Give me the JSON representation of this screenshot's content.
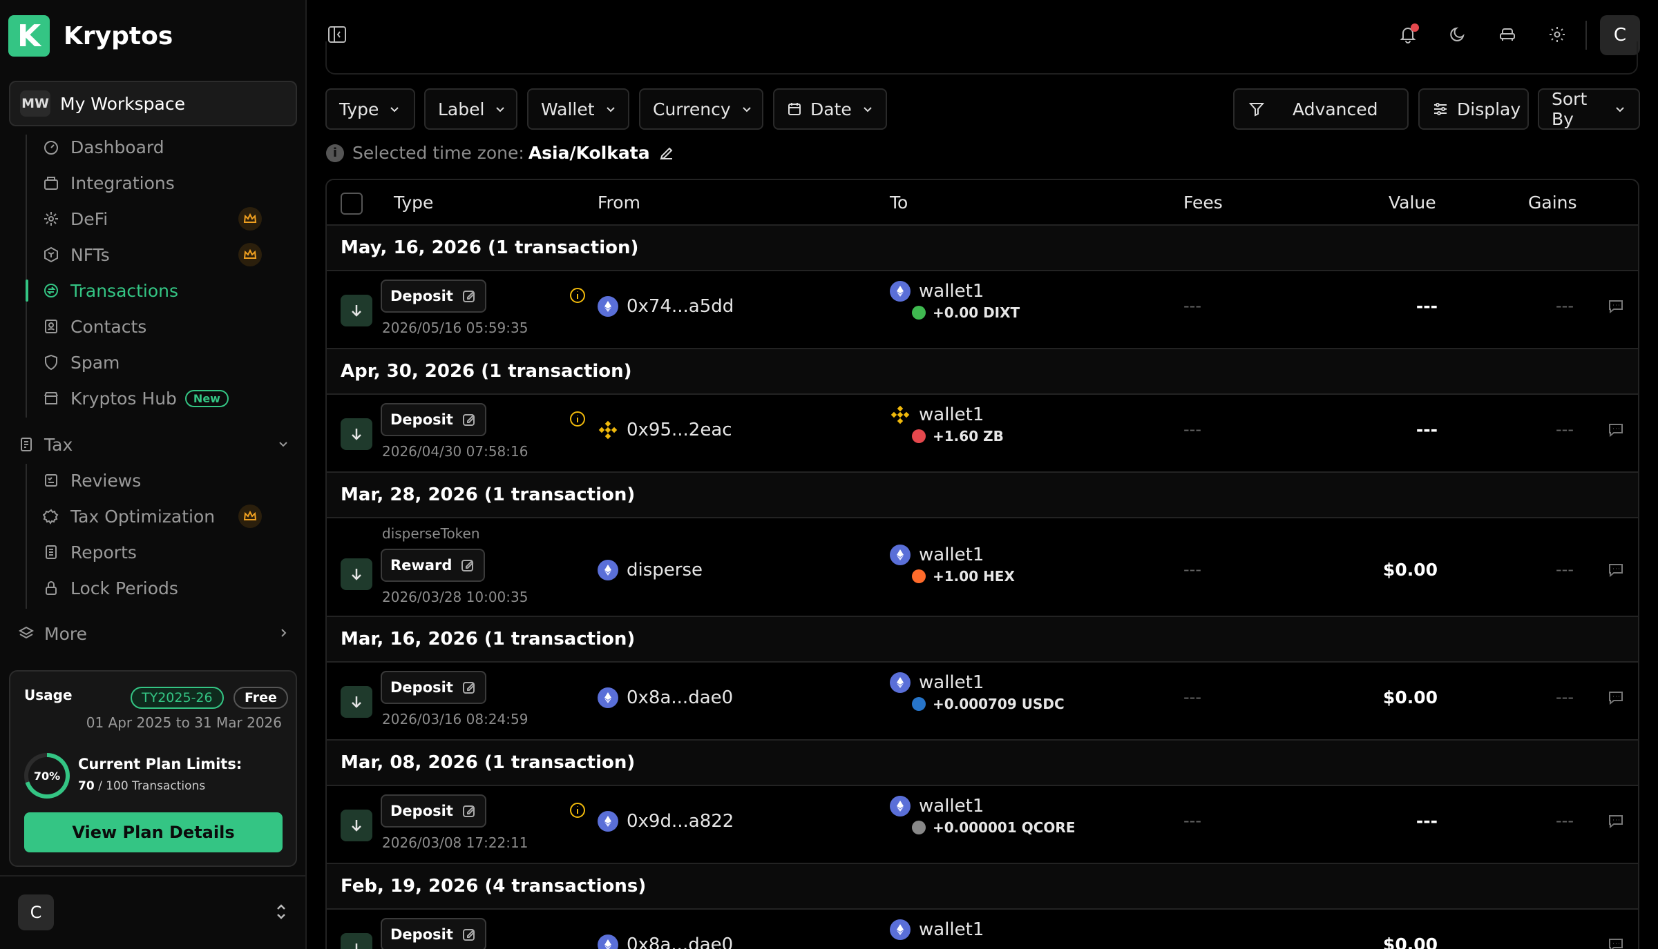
{
  "brand": {
    "logo_letter": "K",
    "name": "Kryptos",
    "accent": "#34c584"
  },
  "workspace": {
    "badge": "MW",
    "name": "My Workspace"
  },
  "nav": {
    "items": [
      {
        "label": "Dashboard",
        "icon": "dashboard-icon"
      },
      {
        "label": "Integrations",
        "icon": "integrations-icon"
      },
      {
        "label": "DeFi",
        "icon": "defi-icon",
        "premium": true
      },
      {
        "label": "NFTs",
        "icon": "nfts-icon",
        "premium": true
      },
      {
        "label": "Transactions",
        "icon": "transactions-icon",
        "active": true
      },
      {
        "label": "Contacts",
        "icon": "contacts-icon"
      },
      {
        "label": "Spam",
        "icon": "spam-icon"
      },
      {
        "label": "Kryptos Hub",
        "icon": "hub-icon",
        "badge": "New"
      }
    ],
    "tax": {
      "label": "Tax",
      "items": [
        "Reviews",
        "Tax Optimization",
        "Reports",
        "Lock Periods"
      ]
    },
    "more": "More"
  },
  "usage": {
    "title": "Usage",
    "tax_year": "TY2025-26",
    "plan": "Free",
    "range": "01 Apr 2025 to 31 Mar 2026",
    "percent_label": "70%",
    "percent": 70,
    "limits_title": "Current Plan Limits:",
    "used": "70",
    "limit_text": "/ 100 Transactions",
    "button": "View Plan Details"
  },
  "user": {
    "initial": "C"
  },
  "topbar": {
    "avatar": "C"
  },
  "filters": {
    "type": "Type",
    "label": "Label",
    "wallet": "Wallet",
    "currency": "Currency",
    "date": "Date",
    "advanced": "Advanced",
    "display": "Display",
    "sort": "Sort By"
  },
  "timezone": {
    "label": "Selected time zone:",
    "value": "Asia/Kolkata"
  },
  "table": {
    "headers": {
      "type": "Type",
      "from": "From",
      "to": "To",
      "fees": "Fees",
      "value": "Value",
      "gains": "Gains"
    },
    "groups": [
      {
        "title": "May, 16, 2026 (1 transaction)",
        "tx": {
          "type": "Deposit",
          "sub": "",
          "date": "2026/05/16 05:59:35",
          "warn": true,
          "from_chain": "eth",
          "from": "0x74...a5dd",
          "to_chain": "eth",
          "to": "wallet1",
          "amount": "+0.00 DIXT",
          "token_color": "#3fb950",
          "fees": "---",
          "value": "---",
          "gains": "---"
        }
      },
      {
        "title": "Apr, 30, 2026 (1 transaction)",
        "tx": {
          "type": "Deposit",
          "sub": "",
          "date": "2026/04/30 07:58:16",
          "warn": true,
          "from_chain": "bnb",
          "from": "0x95...2eac",
          "to_chain": "bnb",
          "to": "wallet1",
          "amount": "+1.60 ZB",
          "token_color": "#e5484d",
          "fees": "---",
          "value": "---",
          "gains": "---"
        }
      },
      {
        "title": "Mar, 28, 2026 (1 transaction)",
        "tx": {
          "type": "Reward",
          "sub": "disperseToken",
          "date": "2026/03/28 10:00:35",
          "warn": false,
          "from_chain": "eth",
          "from": "disperse",
          "to_chain": "eth",
          "to": "wallet1",
          "amount": "+1.00 HEX",
          "token_color": "#ff6b2b",
          "fees": "---",
          "value": "$0.00",
          "gains": "---"
        }
      },
      {
        "title": "Mar, 16, 2026 (1 transaction)",
        "tx": {
          "type": "Deposit",
          "sub": "",
          "date": "2026/03/16 08:24:59",
          "warn": false,
          "from_chain": "eth",
          "from": "0x8a...dae0",
          "to_chain": "eth",
          "to": "wallet1",
          "amount": "+0.000709 USDC",
          "token_color": "#2775ca",
          "fees": "---",
          "value": "$0.00",
          "gains": "---"
        }
      },
      {
        "title": "Mar, 08, 2026 (1 transaction)",
        "tx": {
          "type": "Deposit",
          "sub": "",
          "date": "2026/03/08 17:22:11",
          "warn": true,
          "from_chain": "eth",
          "from": "0x9d...a822",
          "to_chain": "eth",
          "to": "wallet1",
          "amount": "+0.000001 QCORE",
          "token_color": "#888888",
          "fees": "---",
          "value": "---",
          "gains": "---"
        }
      },
      {
        "title": "Feb, 19, 2026 (4 transactions)",
        "tx": {
          "type": "Deposit",
          "sub": "",
          "date": "",
          "warn": false,
          "from_chain": "eth",
          "from": "0x8a...dae0",
          "to_chain": "eth",
          "to": "wallet1",
          "amount": "",
          "token_color": "#2775ca",
          "fees": "",
          "value": "$0.00",
          "gains": ""
        }
      }
    ]
  }
}
